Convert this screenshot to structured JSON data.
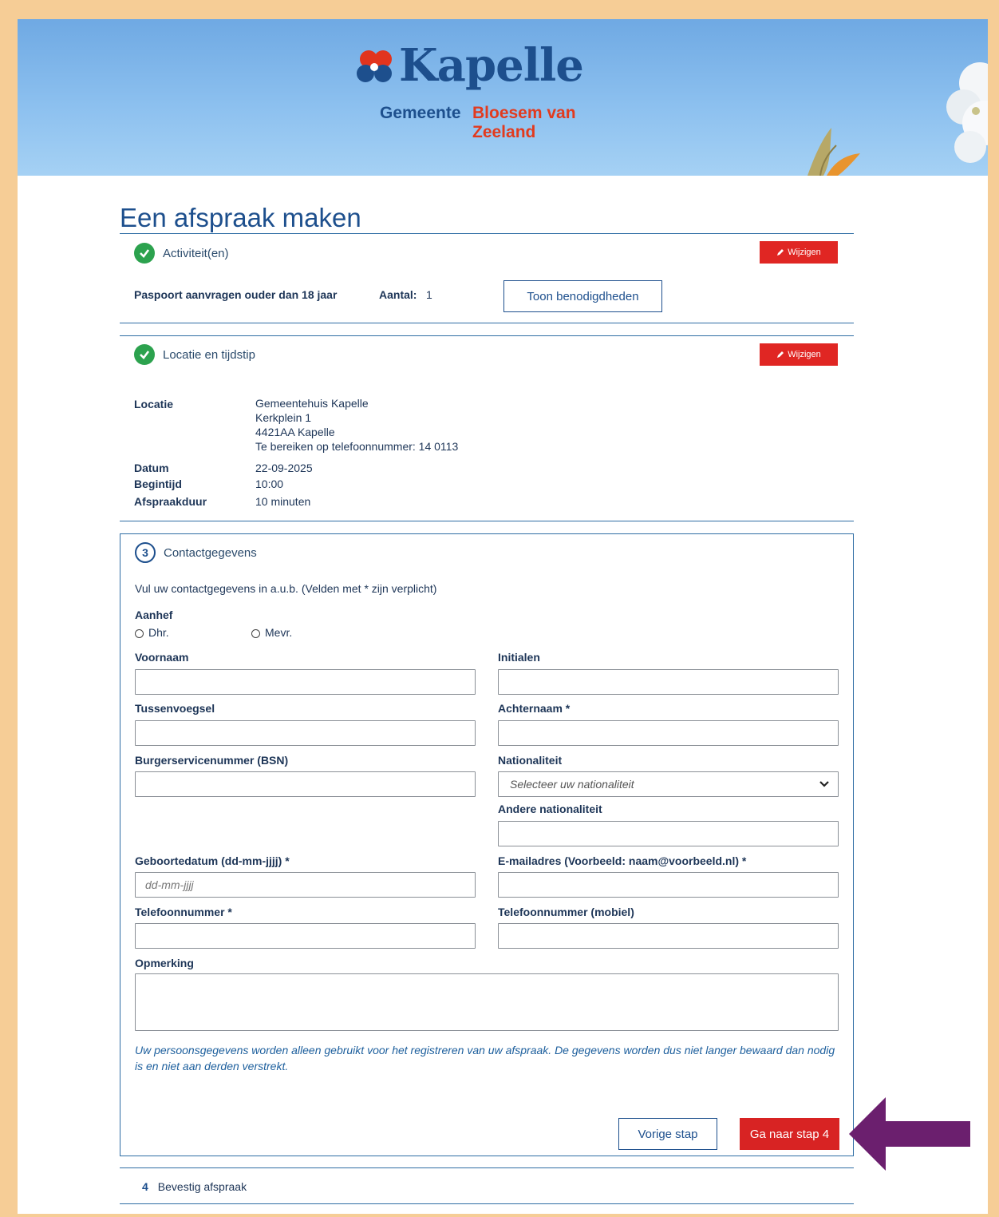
{
  "logo": {
    "word": "Kapelle",
    "gemeente": "Gemeente",
    "tagline": "Bloesem van Zeeland"
  },
  "page_title": "Een afspraak maken",
  "step1": {
    "title": "Activiteit(en)",
    "edit_label": "Wijzigen",
    "activity": "Paspoort aanvragen ouder dan 18 jaar",
    "count_label": "Aantal:",
    "count_value": "1",
    "requirements_button": "Toon benodigdheden"
  },
  "step2": {
    "title": "Locatie en tijdstip",
    "edit_label": "Wijzigen",
    "location_label": "Locatie",
    "location_lines": [
      "Gemeentehuis Kapelle",
      "Kerkplein 1",
      "4421AA Kapelle",
      "Te bereiken op telefoonnummer: 14 0113"
    ],
    "date_label": "Datum",
    "date_value": "22-09-2025",
    "start_label": "Begintijd",
    "start_value": "10:00",
    "duration_label": "Afspraakduur",
    "duration_value": "10 minuten"
  },
  "step3": {
    "number": "3",
    "title": "Contactgegevens",
    "intro": "Vul uw contactgegevens in a.u.b. (Velden met * zijn verplicht)",
    "salutation_label": "Aanhef",
    "salutation_options": [
      "Dhr.",
      "Mevr."
    ],
    "fields": {
      "first_name": "Voornaam",
      "initials": "Initialen",
      "infix": "Tussenvoegsel",
      "last_name": "Achternaam *",
      "bsn": "Burgerservicenummer (BSN)",
      "nationality": "Nationaliteit",
      "nationality_placeholder": "Selecteer uw nationaliteit",
      "other_nationality": "Andere nationaliteit",
      "birthdate": "Geboortedatum (dd-mm-jjjj) *",
      "birthdate_placeholder": "dd-mm-jjjj",
      "email": "E-mailadres (Voorbeeld: naam@voorbeeld.nl) *",
      "phone": "Telefoonnummer *",
      "mobile": "Telefoonnummer (mobiel)",
      "remark": "Opmerking"
    },
    "privacy_note": "Uw persoonsgegevens worden alleen gebruikt voor het registreren van uw afspraak. De gegevens worden dus niet langer bewaard dan nodig is en niet aan derden verstrekt.",
    "prev_button": "Vorige stap",
    "next_button": "Ga naar stap 4"
  },
  "step4": {
    "number": "4",
    "title": "Bevestig afspraak"
  },
  "colors": {
    "accent": "#1d4f8d",
    "danger": "#e02623",
    "success": "#2ca24e",
    "arrow": "#6b1f6e",
    "frame": "#f6cd96"
  }
}
